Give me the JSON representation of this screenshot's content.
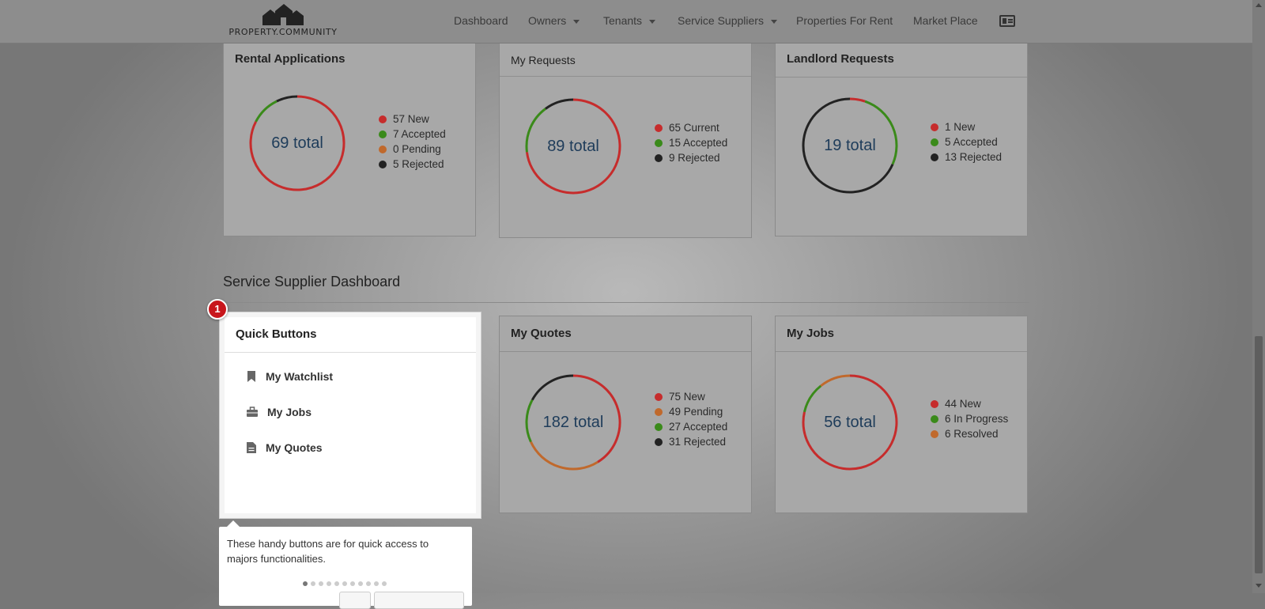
{
  "brand": {
    "name": "PROPERTY.COMMUNITY"
  },
  "nav": {
    "items": [
      {
        "label": "Dashboard",
        "dropdown": false
      },
      {
        "label": "Owners",
        "dropdown": true
      },
      {
        "label": "Tenants",
        "dropdown": true
      },
      {
        "label": "Service Suppliers",
        "dropdown": true
      },
      {
        "label": "Properties For Rent",
        "dropdown": false
      },
      {
        "label": "Market Place",
        "dropdown": false
      }
    ],
    "profile_icon": "id-card-icon"
  },
  "colors": {
    "new": "#c62c2c",
    "accepted": "#3a8a1a",
    "pending": "#c0692c",
    "rejected": "#222222"
  },
  "top_panels": [
    {
      "title": "Rental Applications",
      "total": "69 total",
      "legend": [
        {
          "label": "57 New",
          "color": "#c62c2c"
        },
        {
          "label": "7 Accepted",
          "color": "#3a8a1a"
        },
        {
          "label": "0 Pending",
          "color": "#c0692c"
        },
        {
          "label": "5 Rejected",
          "color": "#222222"
        }
      ],
      "segments": [
        {
          "value": 57,
          "color": "#c62c2c"
        },
        {
          "value": 7,
          "color": "#3a8a1a"
        },
        {
          "value": 0,
          "color": "#c0692c"
        },
        {
          "value": 5,
          "color": "#222222"
        }
      ]
    },
    {
      "title": "My Requests",
      "total": "89 total",
      "legend": [
        {
          "label": "65 Current",
          "color": "#c62c2c"
        },
        {
          "label": "15 Accepted",
          "color": "#3a8a1a"
        },
        {
          "label": "9 Rejected",
          "color": "#222222"
        }
      ],
      "segments": [
        {
          "value": 65,
          "color": "#c62c2c"
        },
        {
          "value": 15,
          "color": "#3a8a1a"
        },
        {
          "value": 9,
          "color": "#222222"
        }
      ]
    },
    {
      "title": "Landlord Requests",
      "total": "19 total",
      "legend": [
        {
          "label": "1 New",
          "color": "#c62c2c"
        },
        {
          "label": "5 Accepted",
          "color": "#3a8a1a"
        },
        {
          "label": "13 Rejected",
          "color": "#222222"
        }
      ],
      "segments": [
        {
          "value": 1,
          "color": "#c62c2c"
        },
        {
          "value": 5,
          "color": "#3a8a1a"
        },
        {
          "value": 13,
          "color": "#222222"
        }
      ]
    }
  ],
  "section": {
    "title": "Service Supplier Dashboard"
  },
  "quick_buttons": {
    "title": "Quick Buttons",
    "items": [
      {
        "label": "My Watchlist",
        "icon": "bookmark-icon"
      },
      {
        "label": "My Jobs",
        "icon": "briefcase-icon"
      },
      {
        "label": "My Quotes",
        "icon": "document-icon"
      }
    ]
  },
  "bottom_panels": [
    {
      "title": "My Quotes",
      "total": "182 total",
      "legend": [
        {
          "label": "75 New",
          "color": "#c62c2c"
        },
        {
          "label": "49 Pending",
          "color": "#c0692c"
        },
        {
          "label": "27 Accepted",
          "color": "#3a8a1a"
        },
        {
          "label": "31 Rejected",
          "color": "#222222"
        }
      ],
      "segments": [
        {
          "value": 75,
          "color": "#c62c2c"
        },
        {
          "value": 49,
          "color": "#c0692c"
        },
        {
          "value": 27,
          "color": "#3a8a1a"
        },
        {
          "value": 31,
          "color": "#222222"
        }
      ]
    },
    {
      "title": "My Jobs",
      "total": "56 total",
      "legend": [
        {
          "label": "44 New",
          "color": "#c62c2c"
        },
        {
          "label": "6 In Progress",
          "color": "#3a8a1a"
        },
        {
          "label": "6 Resolved",
          "color": "#c0692c"
        }
      ],
      "segments": [
        {
          "value": 44,
          "color": "#c62c2c"
        },
        {
          "value": 6,
          "color": "#3a8a1a"
        },
        {
          "value": 6,
          "color": "#c0692c"
        }
      ]
    }
  ],
  "tour": {
    "step": "1",
    "text": "These handy buttons are for quick access to majors functionalities.",
    "total_steps": 11,
    "current_step": 1
  }
}
